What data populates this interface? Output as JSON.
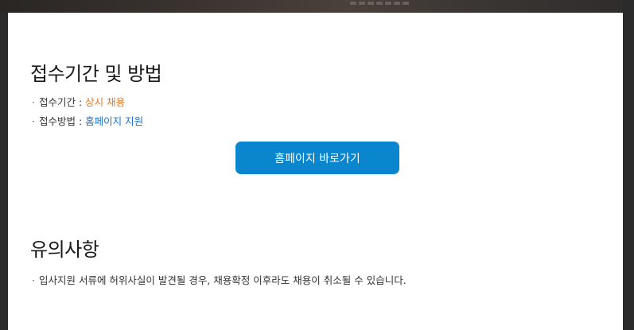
{
  "application": {
    "title": "접수기간 및 방법",
    "period_label": "접수기간 : ",
    "period_value": "상시 채용",
    "method_label": "접수방법 : ",
    "method_value": "홈페이지 지원",
    "homepage_button": "홈페이지 바로가기",
    "bullet": "·"
  },
  "notice": {
    "title": "유의사항",
    "bullet": "·",
    "text": "입사지원 서류에 허위사실이 발견될 경우, 채용확정 이후라도 채용이 취소될 수 있습니다."
  },
  "colors": {
    "accent_orange": "#e87722",
    "accent_blue": "#1a6fd0",
    "button_blue": "#0a86cf"
  }
}
